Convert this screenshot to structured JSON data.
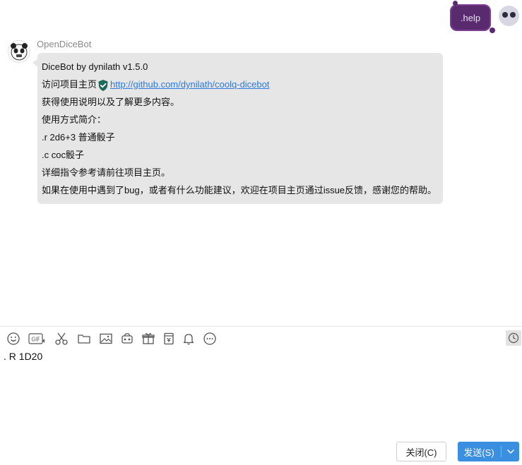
{
  "conversation": {
    "outgoing_message": ".help",
    "bot": {
      "name": "OpenDiceBot",
      "message_lines": {
        "line1": "DiceBot by dynilath v1.5.0",
        "line2_prefix": "访问项目主页",
        "line2_link": "http://github.com/dynilath/coolq-dicebot",
        "line3": "获得使用说明以及了解更多内容。",
        "line4": "使用方式简介：",
        "line5": ".r 2d6+3 普通骰子",
        "line6": ".c coc骰子",
        "line7": "详细指令参考请前往项目主页。",
        "line8": "如果在使用中遇到了bug，或者有什么功能建议，欢迎在项目主页通过issue反馈，感谢您的帮助。"
      }
    }
  },
  "toolbar": {
    "icons": [
      "emoji-icon",
      "gif-icon",
      "scissors-icon",
      "folder-icon",
      "image-icon",
      "shake-icon",
      "gift-icon",
      "red-packet-icon",
      "bell-icon",
      "more-icon"
    ],
    "gif_label": "GIF"
  },
  "input": {
    "value": ". R 1D20"
  },
  "actions": {
    "close_label": "关闭(C)",
    "send_label": "发送(S)"
  },
  "colors": {
    "outgoing_bubble": "#5a2a6f",
    "bot_bubble": "#e6e6e6",
    "link": "#2a7ae2",
    "send_button": "#3b8fe0"
  }
}
